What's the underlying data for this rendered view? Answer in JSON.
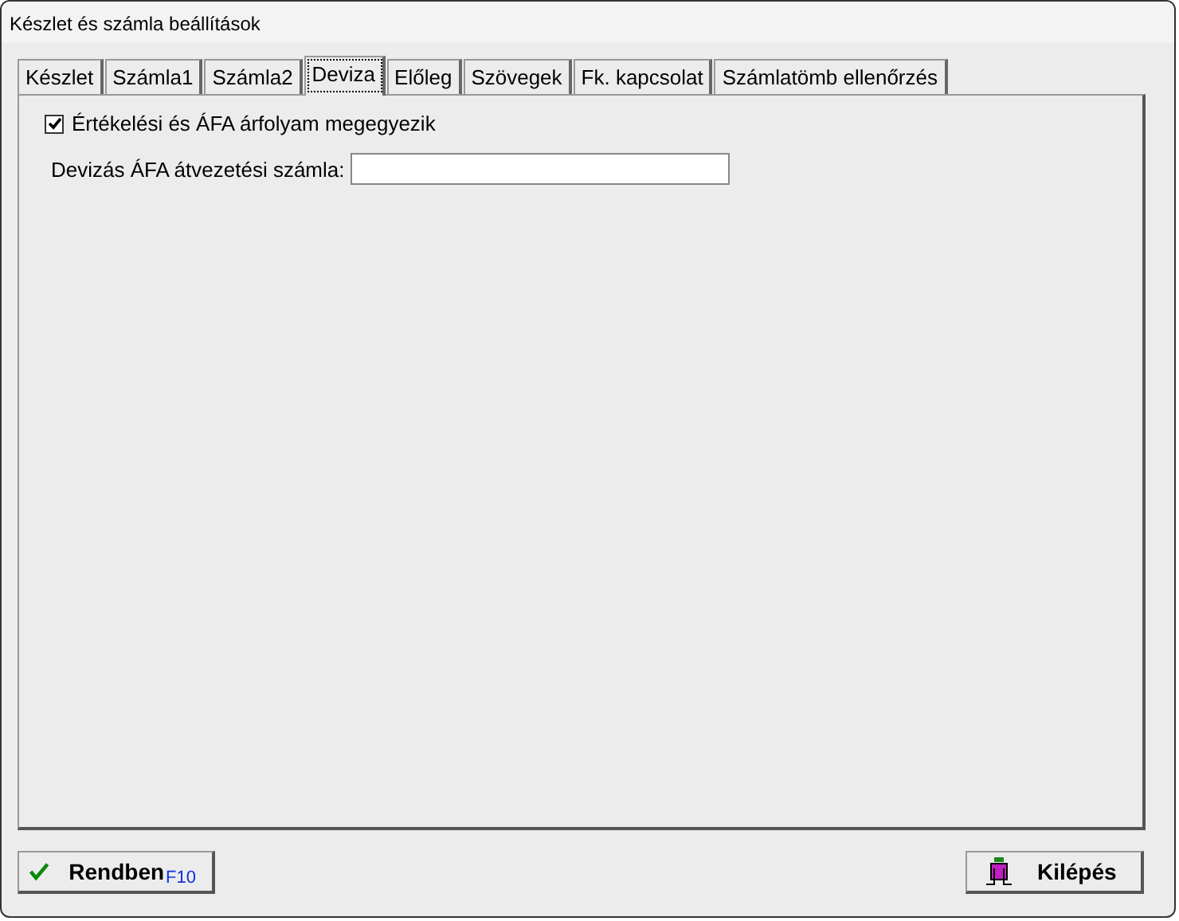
{
  "window": {
    "title": "Készlet és számla beállítások"
  },
  "tabs": [
    {
      "label": "Készlet",
      "selected": false
    },
    {
      "label": "Számla1",
      "selected": false
    },
    {
      "label": "Számla2",
      "selected": false
    },
    {
      "label": "Deviza",
      "selected": true
    },
    {
      "label": "Előleg",
      "selected": false
    },
    {
      "label": "Szövegek",
      "selected": false
    },
    {
      "label": "Fk. kapcsolat",
      "selected": false
    },
    {
      "label": "Számlatömb ellenőrzés",
      "selected": false
    }
  ],
  "checkbox": {
    "label": "Értékelési és ÁFA árfolyam megegyezik",
    "checked": true
  },
  "field": {
    "label": "Devizás ÁFA átvezetési számla:"
  },
  "buttons": [
    {
      "kind": "ok",
      "label": "Rendben",
      "shortcut": "F10"
    },
    {
      "kind": "exit",
      "label": "Kilépés"
    }
  ]
}
